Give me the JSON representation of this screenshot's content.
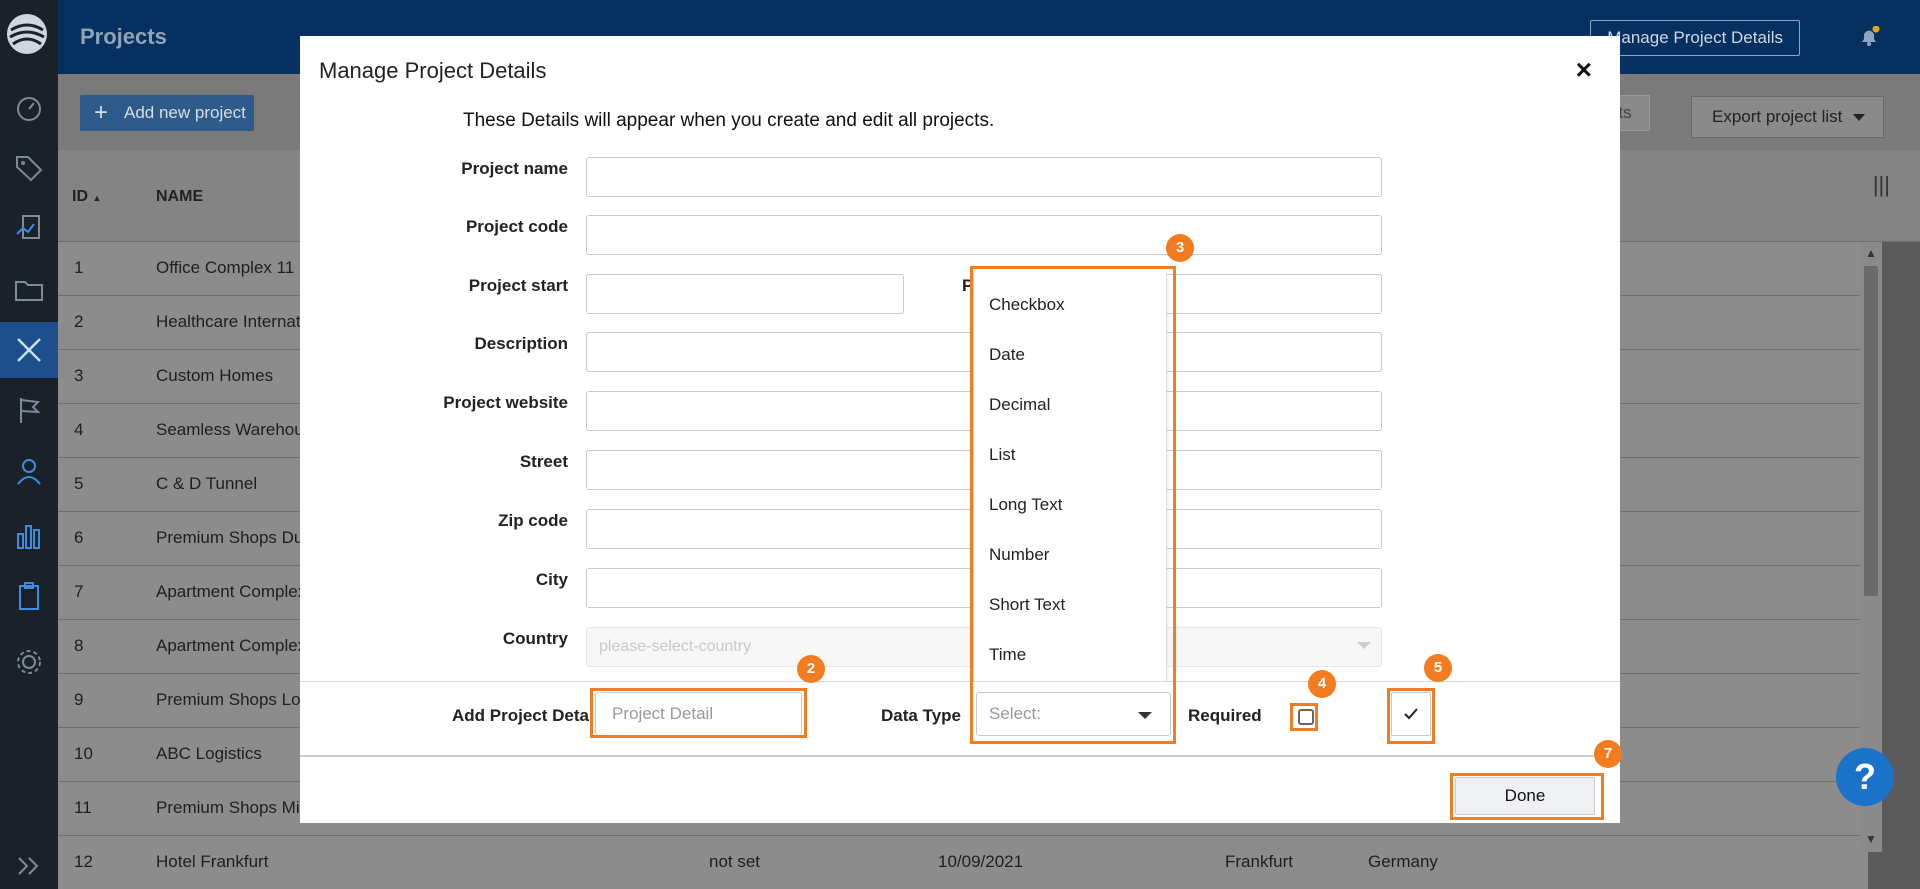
{
  "app": {
    "title": "Projects",
    "manage_btn": "Manage Project Details"
  },
  "toolbar": {
    "add_label": "Add new project",
    "small_btn": "ts",
    "export_label": "Export project list"
  },
  "table": {
    "headers": {
      "id": "ID",
      "name": "NAME"
    },
    "rows": [
      {
        "id": "1",
        "name": "Office Complex 11"
      },
      {
        "id": "2",
        "name": "Healthcare Internat"
      },
      {
        "id": "3",
        "name": "Custom Homes"
      },
      {
        "id": "4",
        "name": "Seamless Warehous"
      },
      {
        "id": "5",
        "name": "C & D Tunnel"
      },
      {
        "id": "6",
        "name": "Premium Shops Dul"
      },
      {
        "id": "7",
        "name": "Apartment Complex"
      },
      {
        "id": "8",
        "name": "Apartment Complex"
      },
      {
        "id": "9",
        "name": "Premium Shops Lor"
      },
      {
        "id": "10",
        "name": "ABC Logistics"
      },
      {
        "id": "11",
        "name": "Premium Shops Mil"
      },
      {
        "id": "12",
        "name": "Hotel Frankfurt",
        "c3": "not set",
        "c4": "10/09/2021",
        "c5": "Frankfurt",
        "c6": "Germany"
      }
    ]
  },
  "modal": {
    "title": "Manage Project Details",
    "close": "×",
    "subtitle": "These Details will appear when you create and edit all projects.",
    "fields": {
      "project_name": "Project name",
      "project_code": "Project code",
      "project_start": "Project start",
      "project_end_partial": "P",
      "description": "Description",
      "project_website": "Project website",
      "street": "Street",
      "zip_code": "Zip code",
      "city": "City",
      "country": "Country"
    },
    "country_placeholder": "please-select-country",
    "dropdown_options": [
      "Checkbox",
      "Date",
      "Decimal",
      "List",
      "Long Text",
      "Number",
      "Short Text",
      "Time"
    ],
    "add_row": {
      "label": "Add Project Detail",
      "placeholder": "Project Detail",
      "data_type_label": "Data Type",
      "select_placeholder": "Select:",
      "required_label": "Required"
    },
    "done_label": "Done"
  },
  "annotations": [
    "2",
    "3",
    "4",
    "5",
    "7"
  ],
  "colors": {
    "accent": "#f47c20",
    "header": "#06305f",
    "help": "#1a73c9"
  }
}
